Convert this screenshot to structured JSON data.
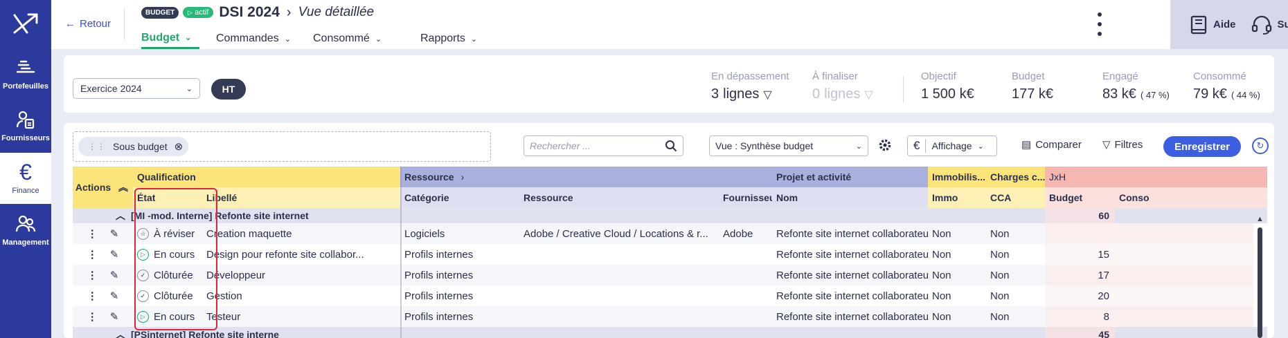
{
  "nav": {
    "items": [
      {
        "label": "Portefeuilles",
        "icon": "portfolio-icon",
        "active": false
      },
      {
        "label": "Fournisseurs",
        "icon": "supplier-icon",
        "active": false
      },
      {
        "label": "Finance",
        "icon": "euro-icon",
        "active": true
      },
      {
        "label": "Management",
        "icon": "people-icon",
        "active": false
      }
    ]
  },
  "header": {
    "back_label": "Retour",
    "badge_budget": "BUDGET",
    "badge_actif": "actif",
    "title": "DSI 2024",
    "subtitle": "Vue détaillée",
    "tabs": [
      "Budget",
      "Commandes",
      "Consommé",
      "Rapports"
    ],
    "help_label": "Aide",
    "support_label": "Support"
  },
  "filters": {
    "exercice": "Exercice 2024",
    "ht": "HT"
  },
  "kpis": {
    "depassement_label": "En dépassement",
    "depassement_count": "3",
    "depassement_unit": "lignes",
    "finaliser_label": "À finaliser",
    "finaliser_count": "0",
    "finaliser_unit": "lignes",
    "objectif_label": "Objectif",
    "objectif_value": "1 500 k€",
    "budget_label": "Budget",
    "budget_value": "177 k€",
    "engage_label": "Engagé",
    "engage_value": "83 k€",
    "engage_pct": "( 47 %)",
    "consomme_label": "Consommé",
    "consomme_value": "79 k€",
    "consomme_pct": "( 44 %)"
  },
  "toolbar": {
    "chip_label": "Sous budget",
    "search_placeholder": "Rechercher ...",
    "vue_label": "Vue : Synthèse budget",
    "affichage_label": "Affichage",
    "euro": "€",
    "comparer_label": "Comparer",
    "filtres_label": "Filtres",
    "enregistrer_label": "Enregistrer"
  },
  "grid": {
    "actions_header": "Actions",
    "groups": {
      "qualification": "Qualification",
      "ressource": "Ressource",
      "projet": "Projet et activité",
      "immobil": "Immobilis...",
      "charges": "Charges c...",
      "jxh": "JxH"
    },
    "columns": {
      "etat": "État",
      "libelle": "Libellé",
      "categorie": "Catégorie",
      "ressource": "Ressource",
      "fournisseur": "Fournisseur",
      "nom": "Nom",
      "immo": "Immo",
      "cca": "CCA",
      "budget": "Budget",
      "conso": "Conso"
    },
    "group_row": {
      "label": "[MI -mod. Interne] Refonte site internet",
      "total": "60"
    },
    "rows": [
      {
        "etat": "À réviser",
        "etat_icon": "star-icon",
        "libelle": "Creation maquette",
        "categorie": "Logiciels",
        "ressource": "Adobe / Creative Cloud / Locations & r...",
        "fournisseur": "Adobe",
        "nom": "Refonte site internet collaborateur",
        "immo": "Non",
        "cca": "Non",
        "budget": ""
      },
      {
        "etat": "En cours",
        "etat_icon": "play-icon",
        "libelle": "Design pour refonte site collabor...",
        "categorie": "Profils internes",
        "ressource": "",
        "fournisseur": "",
        "nom": "Refonte site internet collaborateur",
        "immo": "Non",
        "cca": "Non",
        "budget": "15"
      },
      {
        "etat": "Clôturée",
        "etat_icon": "check-icon",
        "libelle": "Développeur",
        "categorie": "Profils internes",
        "ressource": "",
        "fournisseur": "",
        "nom": "Refonte site internet collaborateur",
        "immo": "Non",
        "cca": "Non",
        "budget": "17"
      },
      {
        "etat": "Clôturée",
        "etat_icon": "check-icon",
        "libelle": "Gestion",
        "categorie": "Profils internes",
        "ressource": "",
        "fournisseur": "",
        "nom": "Refonte site internet collaborateur",
        "immo": "Non",
        "cca": "Non",
        "budget": "20"
      },
      {
        "etat": "En cours",
        "etat_icon": "play-icon",
        "libelle": "Testeur",
        "categorie": "Profils internes",
        "ressource": "",
        "fournisseur": "",
        "nom": "Refonte site internet collaborateur",
        "immo": "Non",
        "cca": "Non",
        "budget": "8"
      }
    ],
    "group_row_2": {
      "label": "[PSinternet] Refonte site interne",
      "total": "45"
    }
  },
  "colors": {
    "nav": "#2b3a9c",
    "accent_green": "#1fa86e",
    "qualification": "#fbe57a",
    "ressource": "#aab0de",
    "jxh": "#f6b7b3",
    "highlight_box": "#e0243a",
    "primary_button": "#3c5ee0"
  }
}
